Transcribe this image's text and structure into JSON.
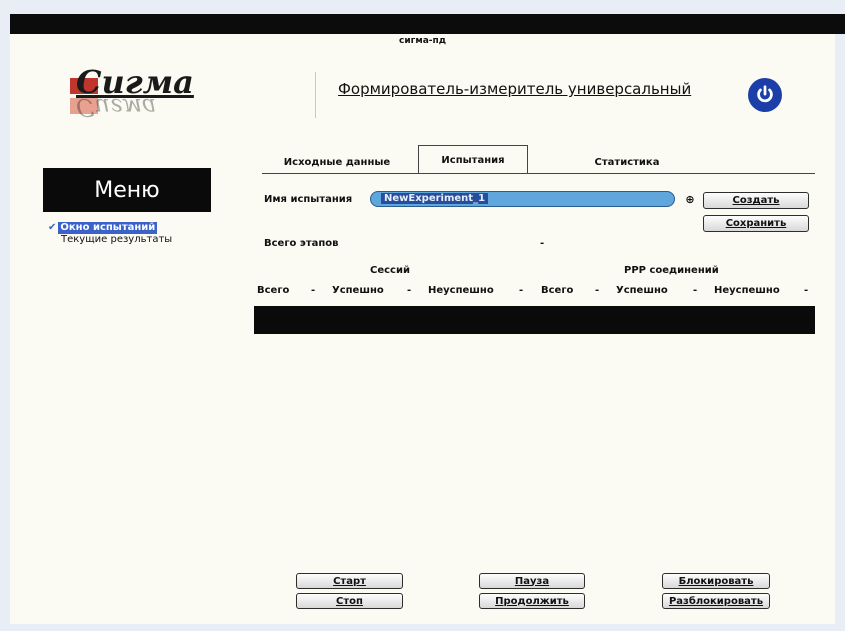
{
  "window": {
    "title": "сигма-пд"
  },
  "header": {
    "logo_text": "Сигма",
    "app_title": "Формирователь-измеритель универсальный"
  },
  "menu": {
    "title": "Меню",
    "items": [
      {
        "label": "Окно испытаний",
        "active": true
      },
      {
        "label": "Текущие результаты",
        "active": false
      }
    ]
  },
  "tabs": [
    {
      "label": "Исходные данные",
      "selected": false
    },
    {
      "label": "Испытания",
      "selected": true
    },
    {
      "label": "Статистика",
      "selected": false
    }
  ],
  "form": {
    "test_name_label": "Имя испытания",
    "test_name_value": "NewExperiment_1",
    "extra_button": "⊕",
    "create_button": "Создать",
    "save_button": "Сохранить",
    "total_stages_label": "Всего этапов",
    "total_stages_value": "-"
  },
  "table": {
    "sessions_header": "Сессий",
    "ppp_header": "PPP соединений",
    "columns": [
      {
        "label": "Всего"
      },
      {
        "label": "-"
      },
      {
        "label": "Успешно"
      },
      {
        "label": "-"
      },
      {
        "label": "Неуспешно"
      },
      {
        "label": "-"
      },
      {
        "label": "Всего"
      },
      {
        "label": "-"
      },
      {
        "label": "Успешно"
      },
      {
        "label": "-"
      },
      {
        "label": "Неуспешно"
      },
      {
        "label": "-"
      }
    ]
  },
  "controls": {
    "start": "Старт",
    "stop": "Стоп",
    "pause": "Пауза",
    "resume": "Продолжить",
    "lock": "Блокировать",
    "unlock": "Разблокировать"
  },
  "colors": {
    "accent": "#3a62c8",
    "power": "#1c3ea8",
    "logo_red": "#c0362c"
  }
}
